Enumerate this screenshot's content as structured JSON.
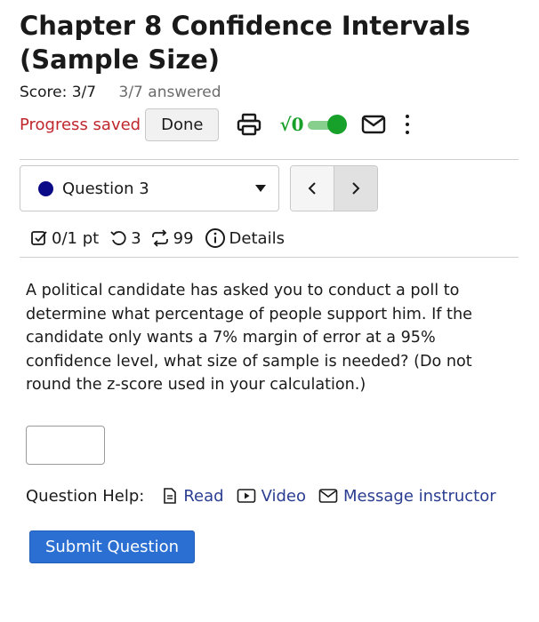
{
  "header": {
    "title": "Chapter 8 Confidence Intervals (Sample Size)",
    "score": "Score: 3/7",
    "answered": "3/7 answered"
  },
  "toolbar": {
    "progress_text": "Progress saved",
    "done_label": "Done",
    "math_toggle_glyph": "√0",
    "icons": [
      "printer-icon",
      "sqrt-icon",
      "toggle",
      "mail-icon",
      "more-vertical-icon"
    ],
    "accent_color": "#17a12a"
  },
  "question_nav": {
    "selected": "Question 3",
    "status_color": "#0b0b87",
    "prev_glyph": "<",
    "next_glyph": ">"
  },
  "question_meta": {
    "points": "0/1 pt",
    "retries": "3",
    "attempts": "99",
    "details_label": "Details"
  },
  "question": {
    "text": "A political candidate has asked you to conduct a poll to determine what percentage of people support him. If the candidate only wants a 7% margin of error at a 95% confidence level, what size of sample is needed? (Do not round the z-score used in your calculation.)",
    "answer_value": ""
  },
  "help": {
    "label": "Question Help:",
    "read": "Read",
    "video": "Video",
    "message": "Message instructor"
  },
  "submit": {
    "label": "Submit Question",
    "color": "#2a6fd1"
  }
}
